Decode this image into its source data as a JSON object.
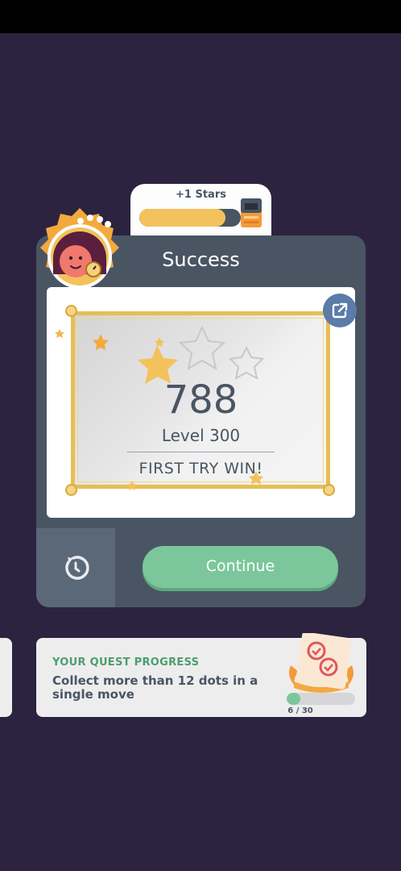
{
  "stars_reward": {
    "label": "+1 Stars",
    "progress": 0.85
  },
  "result": {
    "title": "Success",
    "score": "788",
    "level": "Level 300",
    "badge": "FIRST TRY WIN!",
    "stars_earned": 1,
    "stars_total": 3
  },
  "actions": {
    "continue_label": "Continue",
    "retry_icon": "retry-icon",
    "share_icon": "share-icon"
  },
  "quest": {
    "heading": "YOUR QUEST PROGRESS",
    "description": "Collect more than 12 dots in a single move",
    "current": 6,
    "total": 30,
    "count_text": "6 / 30"
  },
  "colors": {
    "background": "#2b2340",
    "card": "#4a5563",
    "gold": "#e7bd55",
    "green": "#7bc79b",
    "share_blue": "#5b7ba8"
  }
}
